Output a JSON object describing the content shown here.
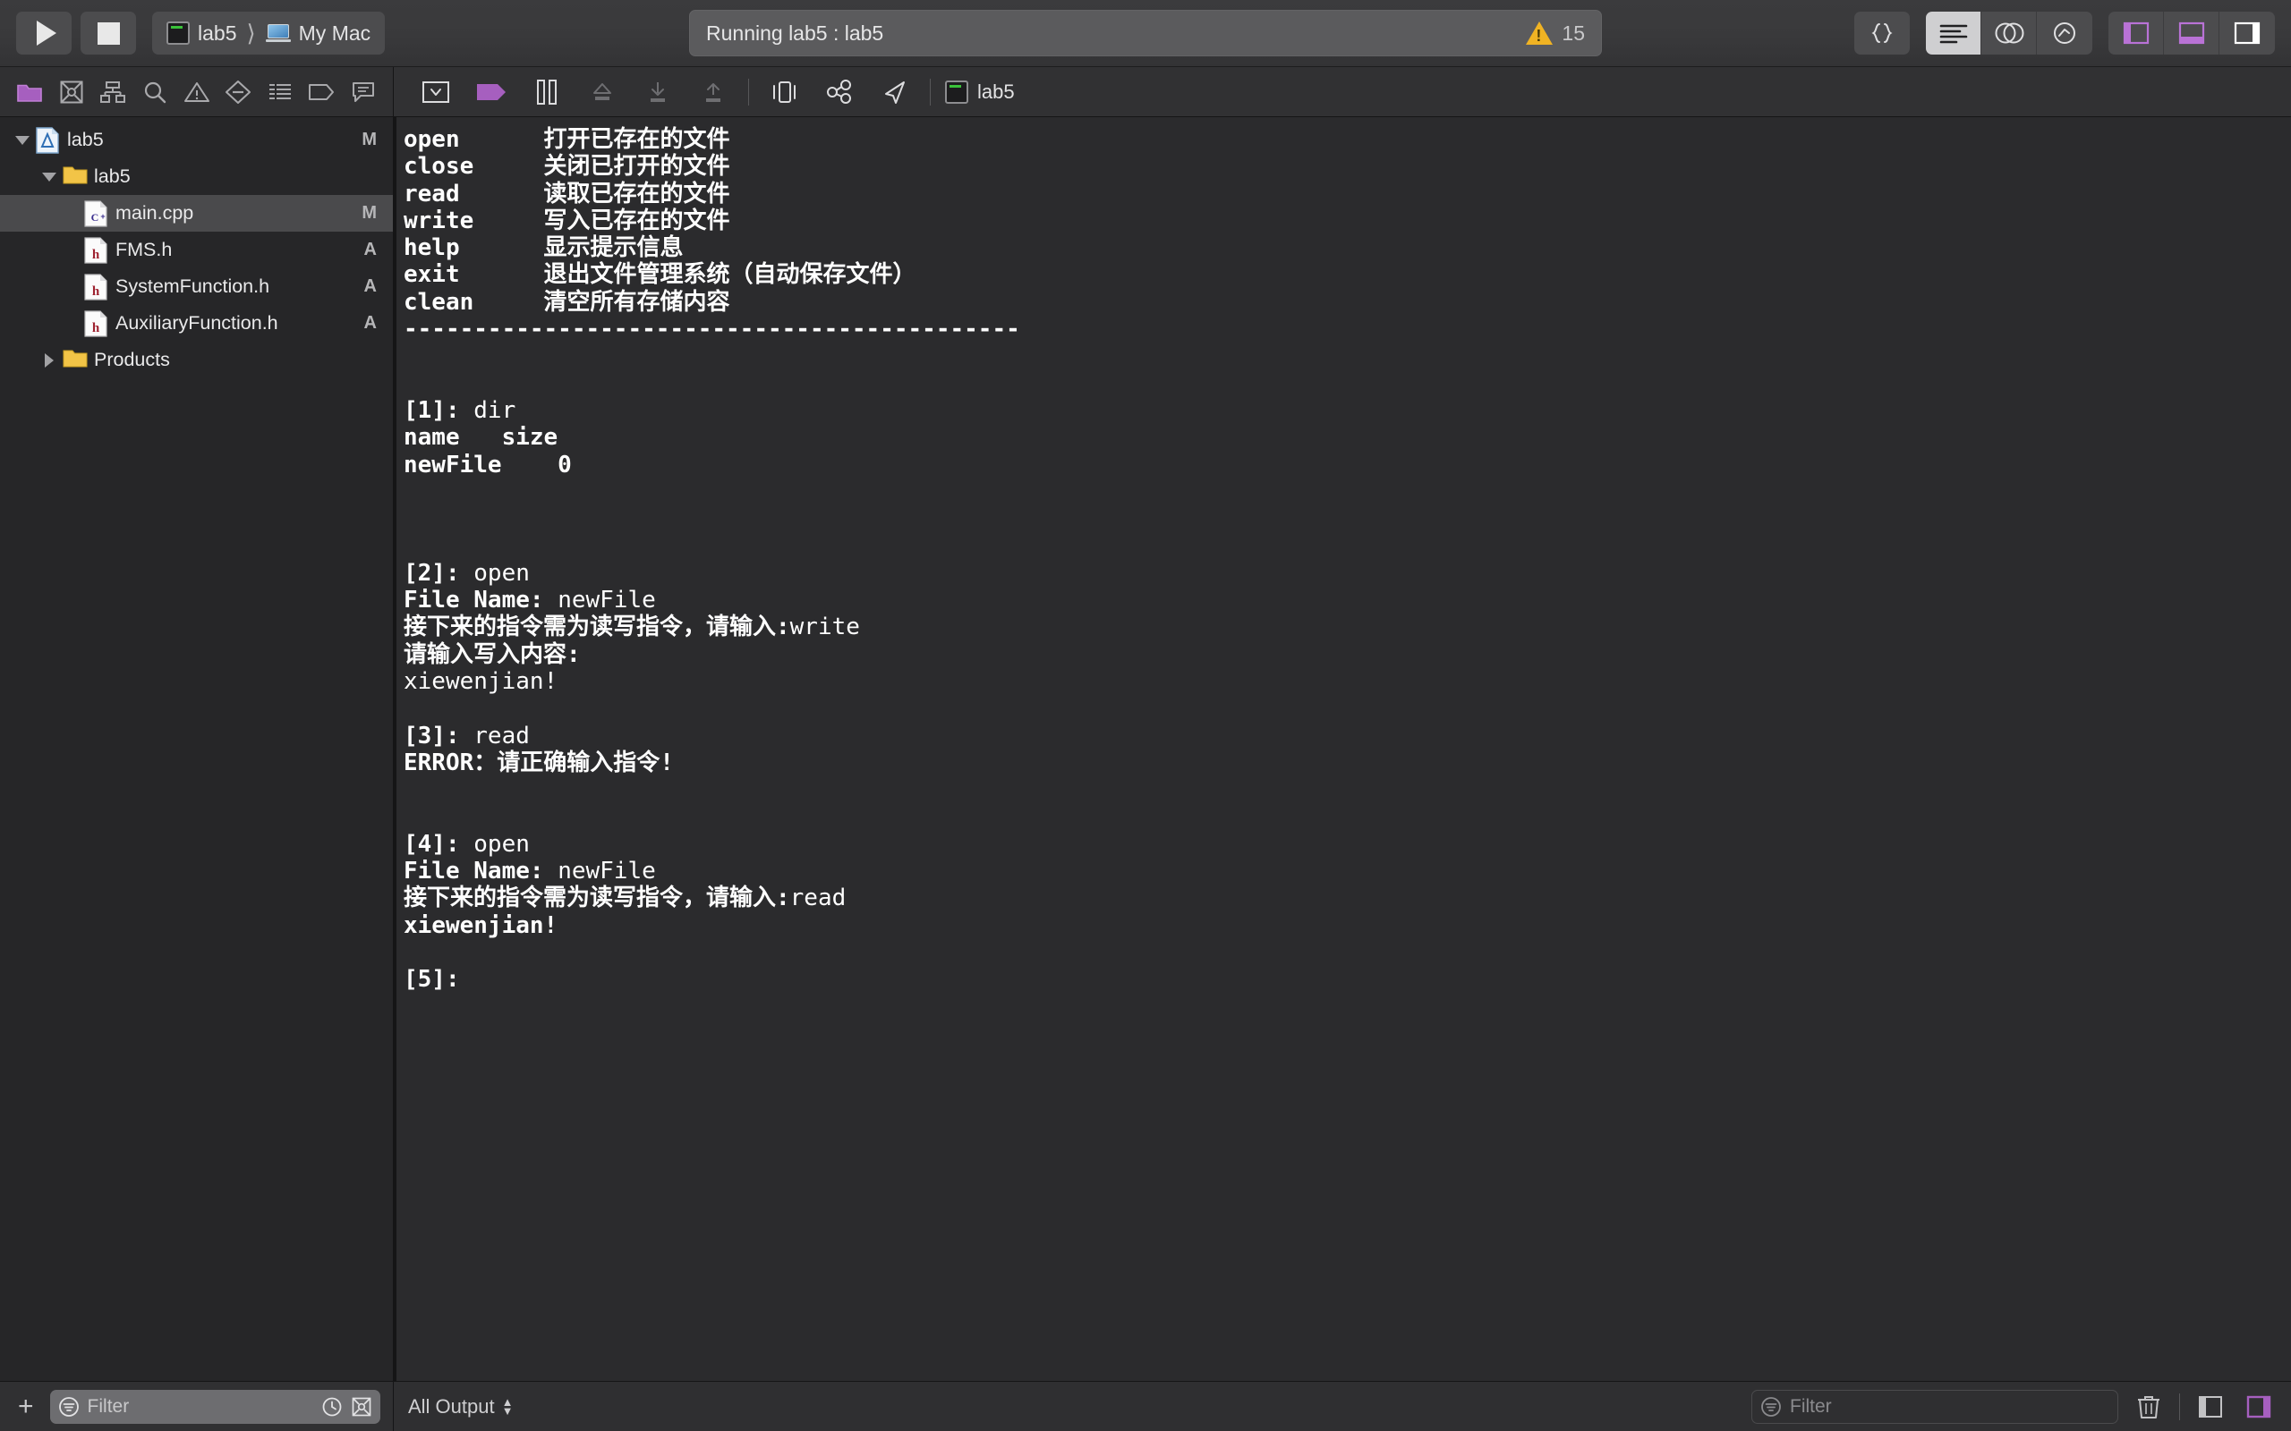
{
  "toolbar": {
    "run_button": "run",
    "stop_button": "stop",
    "scheme_name": "lab5",
    "destination": "My Mac",
    "status_text": "Running lab5 : lab5",
    "warning_count": "15",
    "library_button": "{}",
    "editor_modes": [
      "standard-editor",
      "assistant-editor",
      "version-editor"
    ],
    "panel_toggles": [
      "navigator-toggle",
      "debug-area-toggle",
      "inspector-toggle"
    ],
    "accent_purple": "#a65fbf",
    "warning_yellow": "#f0b323"
  },
  "navigator": {
    "tabs": [
      "project-navigator",
      "source-control-navigator",
      "symbol-navigator",
      "find-navigator",
      "issue-navigator",
      "test-navigator",
      "report-navigator",
      "breakpoint-navigator",
      "debug-navigator"
    ],
    "tree": [
      {
        "label": "lab5",
        "icon": "xcode-project-icon",
        "indent": 0,
        "disclosure": "open",
        "badge": "M",
        "selected": false
      },
      {
        "label": "lab5",
        "icon": "folder-icon",
        "indent": 1,
        "disclosure": "open",
        "badge": "",
        "selected": false
      },
      {
        "label": "main.cpp",
        "icon": "cpp-file-icon",
        "indent": 2,
        "disclosure": "none",
        "badge": "M",
        "selected": true
      },
      {
        "label": "FMS.h",
        "icon": "header-file-icon",
        "indent": 2,
        "disclosure": "none",
        "badge": "A",
        "selected": false
      },
      {
        "label": "SystemFunction.h",
        "icon": "header-file-icon",
        "indent": 2,
        "disclosure": "none",
        "badge": "A",
        "selected": false
      },
      {
        "label": "AuxiliaryFunction.h",
        "icon": "header-file-icon",
        "indent": 2,
        "disclosure": "none",
        "badge": "A",
        "selected": false
      },
      {
        "label": "Products",
        "icon": "folder-icon",
        "indent": 1,
        "disclosure": "closed",
        "badge": "",
        "selected": false
      }
    ],
    "add_button": "+",
    "filter_placeholder": "Filter",
    "filter_value": ""
  },
  "debug_bar": {
    "hide_debug_area": "hide-debug-area",
    "breakpoints_active": "breakpoints-toggle",
    "continue_pause": "pause-button",
    "step_over": "step-over-button",
    "step_into": "step-into-button",
    "step_out": "step-out-button",
    "view_hierarchy": "debug-view-hierarchy-button",
    "memory_graph": "memory-graph-button",
    "simulate_location": "simulate-location-button",
    "process_name": "lab5"
  },
  "console": {
    "lines": [
      [
        {
          "t": "open      ",
          "w": "b"
        },
        {
          "t": "打开已存在的文件",
          "w": "b"
        }
      ],
      [
        {
          "t": "close     ",
          "w": "b"
        },
        {
          "t": "关闭已打开的文件",
          "w": "b"
        }
      ],
      [
        {
          "t": "read      ",
          "w": "b"
        },
        {
          "t": "读取已存在的文件",
          "w": "b"
        }
      ],
      [
        {
          "t": "write     ",
          "w": "b"
        },
        {
          "t": "写入已存在的文件",
          "w": "b"
        }
      ],
      [
        {
          "t": "help      ",
          "w": "b"
        },
        {
          "t": "显示提示信息",
          "w": "b"
        }
      ],
      [
        {
          "t": "exit      ",
          "w": "b"
        },
        {
          "t": "退出文件管理系统（自动保存文件）",
          "w": "b"
        }
      ],
      [
        {
          "t": "clean     ",
          "w": "b"
        },
        {
          "t": "清空所有存储内容",
          "w": "b"
        }
      ],
      [
        {
          "t": "--------------------------------------------",
          "w": "b"
        }
      ],
      [
        {
          "t": "",
          "w": "b"
        }
      ],
      [
        {
          "t": "",
          "w": "b"
        }
      ],
      [
        {
          "t": "[1]: ",
          "w": "b"
        },
        {
          "t": "dir",
          "w": "r"
        }
      ],
      [
        {
          "t": "name   size",
          "w": "b"
        }
      ],
      [
        {
          "t": "newFile    0",
          "w": "b"
        }
      ],
      [
        {
          "t": "",
          "w": "b"
        }
      ],
      [
        {
          "t": "",
          "w": "b"
        }
      ],
      [
        {
          "t": "",
          "w": "b"
        }
      ],
      [
        {
          "t": "[2]: ",
          "w": "b"
        },
        {
          "t": "open",
          "w": "r"
        }
      ],
      [
        {
          "t": "File Name: ",
          "w": "b"
        },
        {
          "t": "newFile",
          "w": "r"
        }
      ],
      [
        {
          "t": "接下来的指令需为读写指令，请输入:",
          "w": "b"
        },
        {
          "t": "write",
          "w": "r"
        }
      ],
      [
        {
          "t": "请输入写入内容:",
          "w": "b"
        }
      ],
      [
        {
          "t": "xiewenjian!",
          "w": "r"
        }
      ],
      [
        {
          "t": "",
          "w": "b"
        }
      ],
      [
        {
          "t": "[3]: ",
          "w": "b"
        },
        {
          "t": "read",
          "w": "r"
        }
      ],
      [
        {
          "t": "ERROR：请正确输入指令!",
          "w": "b"
        }
      ],
      [
        {
          "t": "",
          "w": "b"
        }
      ],
      [
        {
          "t": "",
          "w": "b"
        }
      ],
      [
        {
          "t": "[4]: ",
          "w": "b"
        },
        {
          "t": "open",
          "w": "r"
        }
      ],
      [
        {
          "t": "File Name: ",
          "w": "b"
        },
        {
          "t": "newFile",
          "w": "r"
        }
      ],
      [
        {
          "t": "接下来的指令需为读写指令，请输入:",
          "w": "b"
        },
        {
          "t": "read",
          "w": "r"
        }
      ],
      [
        {
          "t": "xiewenjian!",
          "w": "b"
        }
      ],
      [
        {
          "t": "",
          "w": "b"
        }
      ],
      [
        {
          "t": "[5]:",
          "w": "b"
        }
      ]
    ],
    "output_scope": "All Output",
    "filter_placeholder": "Filter",
    "filter_value": "",
    "clear_button": "trash-icon",
    "variables_pane_toggle": "variables-pane-button",
    "console-pane-toggle": "console-pane-button"
  }
}
